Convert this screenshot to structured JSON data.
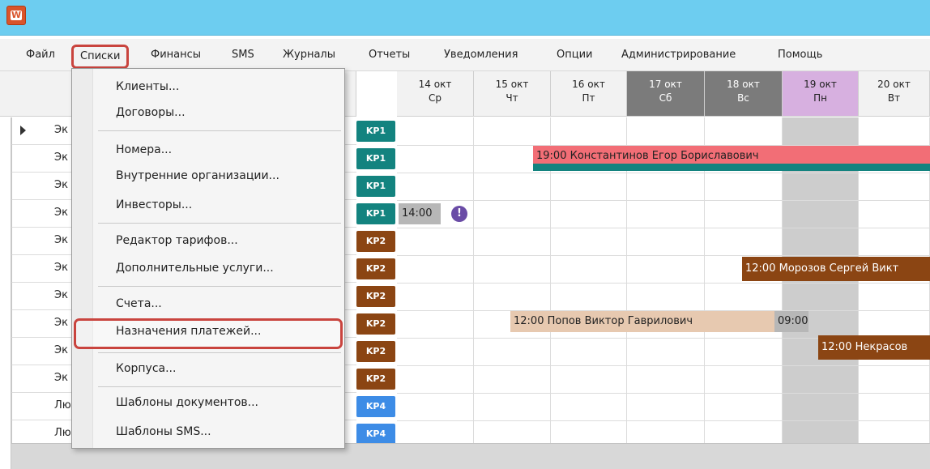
{
  "menubar": {
    "items": [
      "Файл",
      "Списки",
      "Финансы",
      "SMS",
      "Журналы",
      "Отчеты",
      "Уведомления",
      "Опции",
      "Администрирование",
      "Помощь"
    ]
  },
  "calendar": {
    "days": [
      {
        "date": "14 окт",
        "weekday": "Ср"
      },
      {
        "date": "15 окт",
        "weekday": "Чт"
      },
      {
        "date": "16 окт",
        "weekday": "Пт"
      },
      {
        "date": "17 окт",
        "weekday": "Сб"
      },
      {
        "date": "18 окт",
        "weekday": "Вс"
      },
      {
        "date": "19 окт",
        "weekday": "Пн"
      },
      {
        "date": "20 окт",
        "weekday": "Вт"
      }
    ],
    "rows": [
      {
        "name": "Эк",
        "room": "KP1"
      },
      {
        "name": "Эк",
        "room": "KP1"
      },
      {
        "name": "Эк",
        "room": "KP1"
      },
      {
        "name": "Эк",
        "room": "KP1"
      },
      {
        "name": "Эк",
        "room": "KP2"
      },
      {
        "name": "Эк",
        "room": "KP2"
      },
      {
        "name": "Эк",
        "room": "KP2"
      },
      {
        "name": "Эк",
        "room": "KP2"
      },
      {
        "name": "Эк",
        "room": "KP2"
      },
      {
        "name": "Эк",
        "room": "KP2"
      },
      {
        "name": "Лю",
        "room": "KP4"
      },
      {
        "name": "Лю",
        "room": "KP4"
      }
    ],
    "bookings": {
      "b1": "19:00 Константинов Егор Бориславович",
      "b2": "14:00",
      "b3": "12:00 Морозов Сергей Викт",
      "b4": "12:00 Попов Виктор Гаврилович",
      "b5": "09:00",
      "b6": "12:00 Некрасов"
    },
    "warn_symbol": "!"
  },
  "dropdown": {
    "items": [
      "Клиенты...",
      "Договоры...",
      "Номера...",
      "Внутренние организации...",
      "Инвесторы...",
      "Редактор тарифов...",
      "Дополнительные услуги...",
      "Счета...",
      "Назначения платежей...",
      "Корпуса...",
      "Шаблоны документов...",
      "Шаблоны SMS..."
    ]
  },
  "colors": {
    "titlebar": "#6dcdf0",
    "highlight": "#c9443e",
    "room_kp1": "#13837f",
    "room_kp2": "#8b4513",
    "room_kp4": "#3d8ce6",
    "booking_pink": "#f26e76",
    "booking_tan": "#e7c9b0",
    "today": "#d7b0e0"
  }
}
